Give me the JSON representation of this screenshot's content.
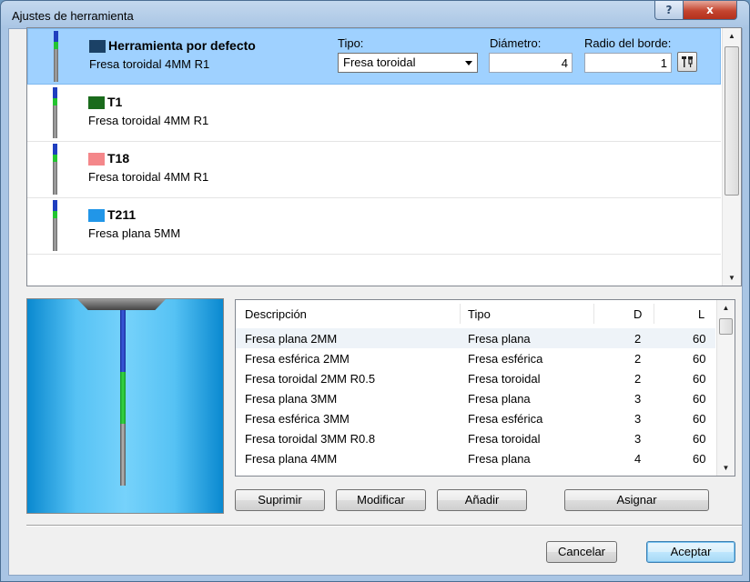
{
  "window": {
    "title": "Ajustes de herramienta",
    "help_glyph": "?",
    "close_glyph": "x"
  },
  "tools": [
    {
      "name": "Herramienta por defecto",
      "desc": "Fresa toroidal 4MM R1",
      "color": "#1b4166",
      "selected": true
    },
    {
      "name": "T1",
      "desc": "Fresa toroidal 4MM R1",
      "color": "#1a6b1c",
      "selected": false
    },
    {
      "name": "T18",
      "desc": "Fresa toroidal 4MM R1",
      "color": "#f4878a",
      "selected": false
    },
    {
      "name": "T211",
      "desc": "Fresa plana 5MM",
      "color": "#2196e8",
      "selected": false
    }
  ],
  "fields": {
    "tipo_label": "Tipo:",
    "tipo_value": "Fresa toroidal",
    "diametro_label": "Diámetro:",
    "diametro_value": "4",
    "radio_label": "Radio del borde:",
    "radio_value": "1"
  },
  "table": {
    "headers": {
      "desc": "Descripción",
      "tipo": "Tipo",
      "d": "D",
      "l": "L"
    },
    "rows": [
      {
        "desc": "Fresa plana 2MM",
        "tipo": "Fresa plana",
        "d": "2",
        "l": "60"
      },
      {
        "desc": "Fresa esférica 2MM",
        "tipo": "Fresa esférica",
        "d": "2",
        "l": "60"
      },
      {
        "desc": "Fresa toroidal 2MM R0.5",
        "tipo": "Fresa toroidal",
        "d": "2",
        "l": "60"
      },
      {
        "desc": "Fresa plana 3MM",
        "tipo": "Fresa plana",
        "d": "3",
        "l": "60"
      },
      {
        "desc": "Fresa esférica 3MM",
        "tipo": "Fresa esférica",
        "d": "3",
        "l": "60"
      },
      {
        "desc": "Fresa toroidal 3MM R0.8",
        "tipo": "Fresa toroidal",
        "d": "3",
        "l": "60"
      },
      {
        "desc": "Fresa plana 4MM",
        "tipo": "Fresa plana",
        "d": "4",
        "l": "60"
      }
    ]
  },
  "buttons": {
    "suprimir": "Suprimir",
    "modificar": "Modificar",
    "anadir": "Añadir",
    "asignar": "Asignar",
    "cancelar": "Cancelar",
    "aceptar": "Aceptar"
  },
  "icons": {
    "tool_settings": "tool-settings-icon",
    "scroll_up": "▲",
    "scroll_down": "▼"
  }
}
